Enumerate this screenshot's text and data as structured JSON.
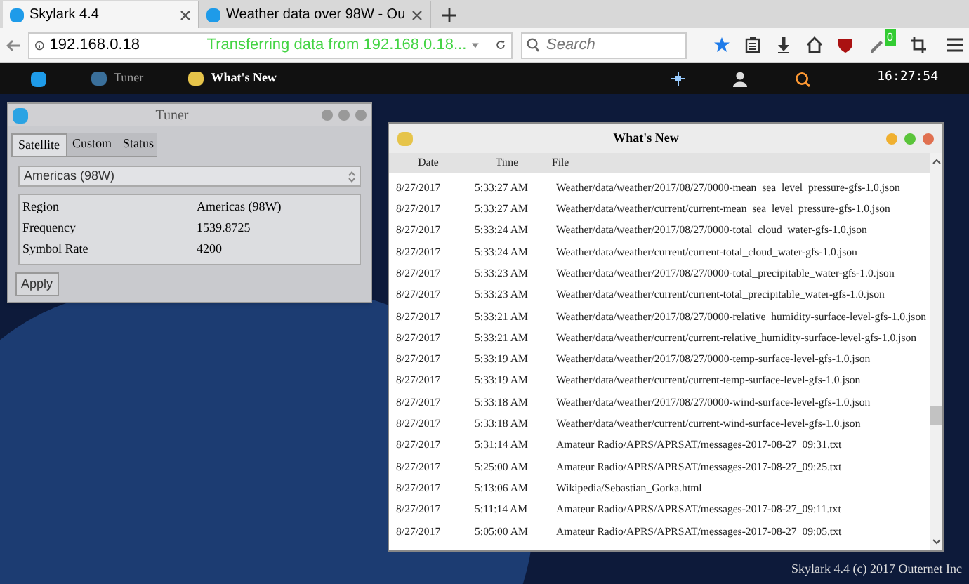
{
  "browser": {
    "tabs": [
      {
        "title": "Skylark 4.4",
        "selected": true
      },
      {
        "title": "Weather data over 98W - Ou",
        "selected": false
      }
    ],
    "address": "192.168.0.18",
    "status": "Transferring data from 192.168.0.18...",
    "search": {
      "placeholder": "Search"
    },
    "badge": "0"
  },
  "app_bar": {
    "items": [
      {
        "label": "Tuner",
        "selected": false
      },
      {
        "label": "What's New",
        "selected": true
      }
    ],
    "clock": "16:27:54"
  },
  "tuner": {
    "title": "Tuner",
    "tabs": [
      {
        "label": "Satellite",
        "selected": true
      },
      {
        "label": "Custom",
        "selected": false
      },
      {
        "label": "Status",
        "selected": false
      }
    ],
    "select": "Americas (98W)",
    "rows": [
      {
        "label": "Region",
        "value": "Americas (98W)"
      },
      {
        "label": "Frequency",
        "value": "1539.8725"
      },
      {
        "label": "Symbol Rate",
        "value": "4200"
      }
    ],
    "button": "Apply"
  },
  "whats_new": {
    "title": "What's New",
    "columns": [
      "Date",
      "Time",
      "File"
    ],
    "rows": [
      [
        "8/27/2017",
        "5:33:27 AM",
        "Weather/data/weather/2017/08/27/0000-mean_sea_level_pressure-gfs-1.0.json"
      ],
      [
        "8/27/2017",
        "5:33:27 AM",
        "Weather/data/weather/current/current-mean_sea_level_pressure-gfs-1.0.json"
      ],
      [
        "8/27/2017",
        "5:33:24 AM",
        "Weather/data/weather/2017/08/27/0000-total_cloud_water-gfs-1.0.json"
      ],
      [
        "8/27/2017",
        "5:33:24 AM",
        "Weather/data/weather/current/current-total_cloud_water-gfs-1.0.json"
      ],
      [
        "8/27/2017",
        "5:33:23 AM",
        "Weather/data/weather/2017/08/27/0000-total_precipitable_water-gfs-1.0.json"
      ],
      [
        "8/27/2017",
        "5:33:23 AM",
        "Weather/data/weather/current/current-total_precipitable_water-gfs-1.0.json"
      ],
      [
        "8/27/2017",
        "5:33:21 AM",
        "Weather/data/weather/2017/08/27/0000-relative_humidity-surface-level-gfs-1.0.json"
      ],
      [
        "8/27/2017",
        "5:33:21 AM",
        "Weather/data/weather/current/current-relative_humidity-surface-level-gfs-1.0.json"
      ],
      [
        "8/27/2017",
        "5:33:19 AM",
        "Weather/data/weather/2017/08/27/0000-temp-surface-level-gfs-1.0.json"
      ],
      [
        "8/27/2017",
        "5:33:19 AM",
        "Weather/data/weather/current/current-temp-surface-level-gfs-1.0.json"
      ],
      [
        "8/27/2017",
        "5:33:18 AM",
        "Weather/data/weather/2017/08/27/0000-wind-surface-level-gfs-1.0.json"
      ],
      [
        "8/27/2017",
        "5:33:18 AM",
        "Weather/data/weather/current/current-wind-surface-level-gfs-1.0.json"
      ],
      [
        "8/27/2017",
        "5:31:14 AM",
        "Amateur Radio/APRS/APRSAT/messages-2017-08-27_09:31.txt"
      ],
      [
        "8/27/2017",
        "5:25:00 AM",
        "Amateur Radio/APRS/APRSAT/messages-2017-08-27_09:25.txt"
      ],
      [
        "8/27/2017",
        "5:13:06 AM",
        "Wikipedia/Sebastian_Gorka.html"
      ],
      [
        "8/27/2017",
        "5:11:14 AM",
        "Amateur Radio/APRS/APRSAT/messages-2017-08-27_09:11.txt"
      ],
      [
        "8/27/2017",
        "5:05:00 AM",
        "Amateur Radio/APRS/APRSAT/messages-2017-08-27_09:05.txt"
      ]
    ]
  },
  "footer": "Skylark 4.4 (c) 2017 Outernet Inc"
}
